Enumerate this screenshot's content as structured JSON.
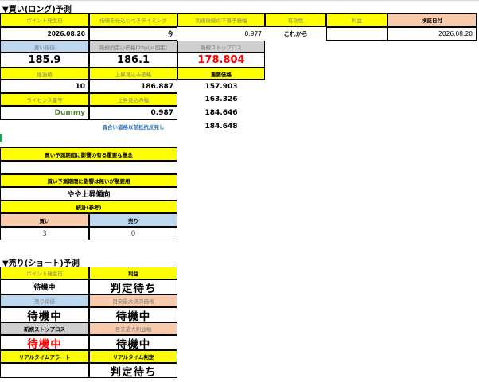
{
  "long": {
    "title": "▼買い(ロング)予測",
    "h_point_date": "ポイント発生日",
    "h_timing": "指値を仕込むべきタイミング",
    "h_lower_limit": "到達後続の下落予想幅",
    "h_valid": "有効性",
    "h_profit": "利益",
    "h_verify_date": "検証日付",
    "v_point_date": "2026.08.20",
    "v_timing": "今",
    "v_lower_limit": "0.977",
    "v_valid": "これから",
    "v_verify_date": "2026.08.20",
    "h_buy_limit": "買い指値",
    "h_new_buy_price": "新規約定い価格(20pips固定)",
    "h_new_stop": "新規ストップロス",
    "v_buy_limit": "185.9",
    "v_new_buy_price": "186.1",
    "v_new_stop": "178.804",
    "h_elapsed": "経過値",
    "h_up_price": "上昇見込み価格",
    "h_important_price": "重要価格",
    "v_elapsed": "10",
    "v_up_price": "186.887",
    "v_imp1": "157.903",
    "h_license": "ライセンス番号",
    "h_up_width": "上昇見込み幅",
    "v_imp2": "163.326",
    "v_license": "Dummy",
    "v_up_width": "0.987",
    "v_imp3": "184.646",
    "h_buy_before_break": "買合い価格以前抵抗反発し",
    "v_imp4": "184.648",
    "q1": "買い予測期間に影響の有る重要な懸念",
    "q1_answer": "",
    "q2": "買い予測期間に影響は無いが懸要用",
    "q2_answer": "やや上昇傾向",
    "h_stats": "統計(参考)",
    "h_buy": "買い",
    "h_sell": "売り",
    "v_buy_count": "3",
    "v_sell_count": "0"
  },
  "short": {
    "title": "▼売り(ショート)予測",
    "h_point_date": "ポイント発生日",
    "h_profit": "利益",
    "v_point_date": "待機中",
    "v_profit": "判定待ち",
    "h_sell_limit": "売り指値",
    "h_target_high": "目安最大決済価格",
    "v_sell_limit": "待機中",
    "v_target_high": "待機中",
    "h_new_stop": "新規ストップロス",
    "h_target_max": "目安最大利益幅",
    "v_new_stop": "待機中",
    "v_target_max": "待機中",
    "h_alert": "リアルタイムアラート",
    "h_rt_judge": "リアルタイム判定",
    "v_alert": "",
    "v_rt_judge": "判定待ち"
  }
}
